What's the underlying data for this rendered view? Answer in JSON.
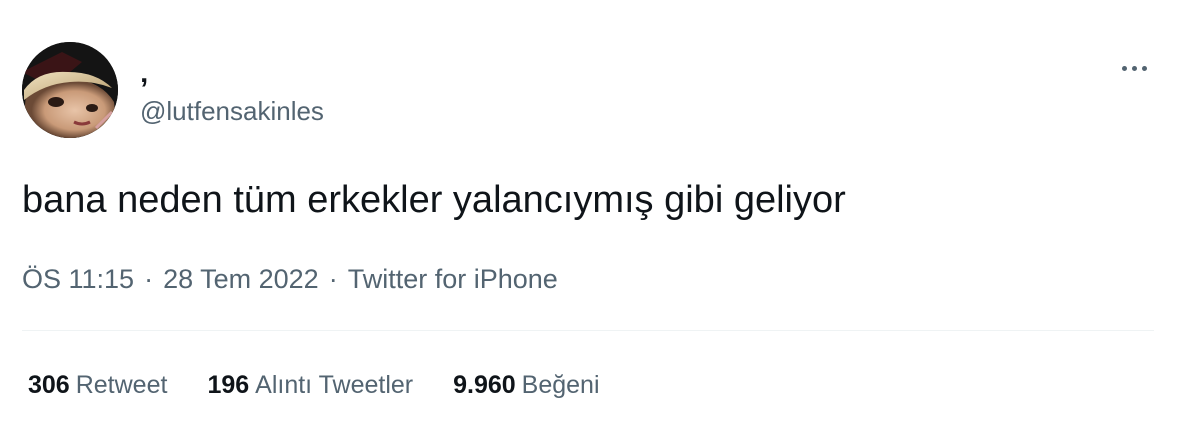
{
  "author": {
    "display_name": "‚",
    "handle": "@lutfensakinles",
    "avatar_icon": "profile-photo"
  },
  "tweet": {
    "text": "bana neden tüm erkekler yalancıymış gibi geliyor"
  },
  "meta": {
    "time": "ÖS 11:15",
    "separator": "·",
    "date": "28 Tem 2022",
    "source": "Twitter for iPhone"
  },
  "stats": {
    "retweets": {
      "count": "306",
      "label": "Retweet"
    },
    "quotes": {
      "count": "196",
      "label": "Alıntı Tweetler"
    },
    "likes": {
      "count": "9.960",
      "label": "Beğeni"
    }
  },
  "more_icon": "more-horizontal-icon",
  "colors": {
    "text_primary": "#0f1419",
    "text_secondary": "#536471",
    "divider": "#eff3f4"
  }
}
